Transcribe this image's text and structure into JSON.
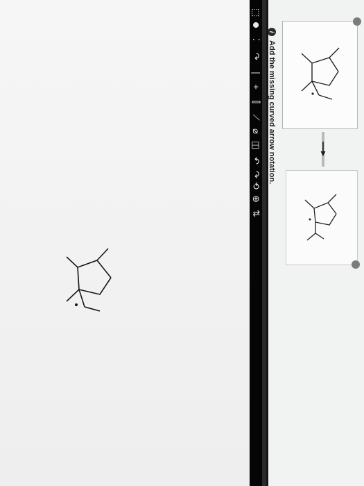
{
  "instruction": {
    "text": "Add the missing curved arrow notation."
  },
  "toolbar": {
    "tools": [
      {
        "name": "select-tool-icon",
        "glyph": "⬚"
      },
      {
        "name": "charge-tool-icon",
        "glyph": "⬤"
      },
      {
        "name": "lone-pair-tool-icon",
        "glyph": "⁚"
      },
      {
        "name": "curved-arrow-tool-icon",
        "glyph": "↷"
      },
      {
        "name": "single-bond-tool-icon",
        "glyph": "∣"
      },
      {
        "name": "plus-tool-icon",
        "glyph": "+"
      },
      {
        "name": "chain-tool-icon",
        "glyph": "⫿"
      },
      {
        "name": "bond-tool-icon",
        "glyph": "⟋"
      },
      {
        "name": "eraser-tool-icon",
        "glyph": "⌀"
      },
      {
        "name": "ring-tool-icon",
        "glyph": "◫"
      },
      {
        "name": "undo-icon",
        "glyph": "↶"
      },
      {
        "name": "redo-icon",
        "glyph": "↷"
      },
      {
        "name": "reset-icon",
        "glyph": "⟲"
      },
      {
        "name": "zoom-icon",
        "glyph": "⊕"
      },
      {
        "name": "settings-icon",
        "glyph": "⇅"
      }
    ]
  }
}
